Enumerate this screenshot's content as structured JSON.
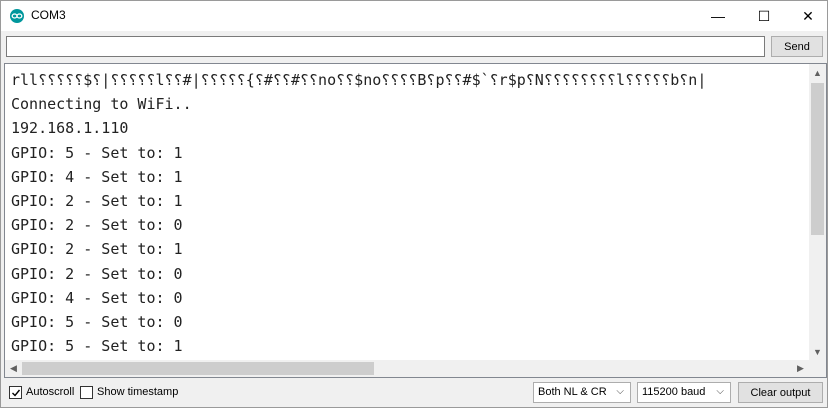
{
  "window": {
    "title": "COM3",
    "minimize_glyph": "—",
    "maximize_glyph": "☐",
    "close_glyph": "✕"
  },
  "send_row": {
    "input_value": "",
    "send_label": "Send"
  },
  "output": {
    "lines": [
      "rll⸮⸮⸮⸮⸮$⸮|⸮⸮⸮⸮⸮l⸮⸮#|⸮⸮⸮⸮⸮{⸮#⸮⸮#⸮⸮no⸮⸮$no⸮⸮⸮⸮B⸮p⸮⸮#$`⸮r$p⸮N⸮⸮⸮⸮⸮⸮⸮⸮l⸮⸮⸮⸮⸮b⸮n|",
      "Connecting to WiFi..",
      "192.168.1.110",
      "GPIO: 5 - Set to: 1",
      "GPIO: 4 - Set to: 1",
      "GPIO: 2 - Set to: 1",
      "GPIO: 2 - Set to: 0",
      "GPIO: 2 - Set to: 1",
      "GPIO: 2 - Set to: 0",
      "GPIO: 4 - Set to: 0",
      "GPIO: 5 - Set to: 0",
      "GPIO: 5 - Set to: 1"
    ]
  },
  "bottom_bar": {
    "autoscroll_label": "Autoscroll",
    "autoscroll_checked": true,
    "timestamp_label": "Show timestamp",
    "timestamp_checked": false,
    "line_ending": "Both NL & CR",
    "baud_rate": "115200 baud",
    "clear_label": "Clear output"
  },
  "icons": {
    "app": "arduino-logo-icon",
    "scroll_up": "chevron-up-icon",
    "scroll_down": "chevron-down-icon",
    "scroll_left": "chevron-left-icon",
    "scroll_right": "chevron-right-icon",
    "dropdown": "chevron-down-icon",
    "check": "checkmark-icon"
  },
  "colors": {
    "app_icon": "#00979c"
  }
}
